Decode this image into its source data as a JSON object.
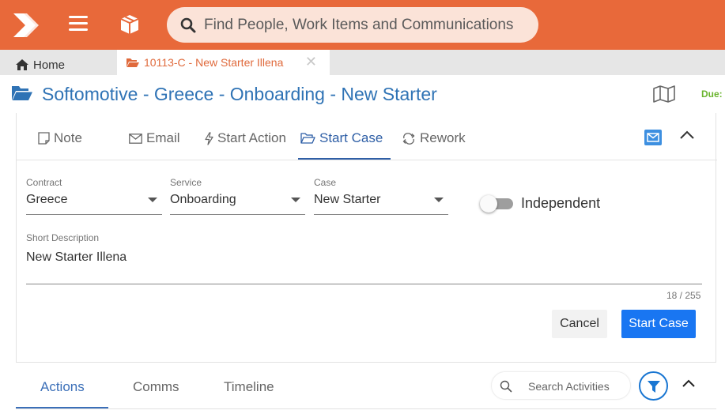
{
  "topbar": {
    "search_placeholder": "Find People, Work Items and Communications",
    "color": "#e8693a"
  },
  "tabs": {
    "home_label": "Home",
    "active_label": "10113-C - New Starter Illena",
    "close_symbol": "✕"
  },
  "header": {
    "title": "Softomotive - Greece - Onboarding - New Starter",
    "due_label": "Due:"
  },
  "action_tabs": [
    {
      "label": "Note",
      "icon": "note-icon"
    },
    {
      "label": "Email",
      "icon": "envelope-icon"
    },
    {
      "label": "Start Action",
      "icon": "lightning-icon"
    },
    {
      "label": "Start Case",
      "icon": "folder-open-icon",
      "active": true
    },
    {
      "label": "Rework",
      "icon": "rework-icon"
    }
  ],
  "form": {
    "contract": {
      "label": "Contract",
      "value": "Greece"
    },
    "service": {
      "label": "Service",
      "value": "Onboarding"
    },
    "case": {
      "label": "Case",
      "value": "New Starter"
    },
    "independent": {
      "label": "Independent",
      "on": false
    },
    "short_description": {
      "label": "Short Description",
      "value": "New Starter Illena"
    },
    "counter": "18 / 255",
    "cancel_label": "Cancel",
    "start_label": "Start Case"
  },
  "bottom_tabs": [
    {
      "label": "Actions",
      "active": true
    },
    {
      "label": "Comms"
    },
    {
      "label": "Timeline"
    }
  ],
  "activity_search_placeholder": "Search Activities",
  "colors": {
    "accent_blue": "#2f73b5",
    "primary_button": "#1976f2",
    "due_green": "#6ab42e"
  }
}
